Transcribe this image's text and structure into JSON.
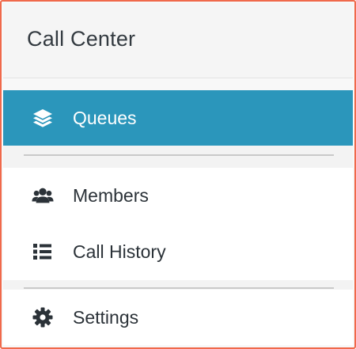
{
  "header": {
    "title": "Call Center"
  },
  "nav": {
    "items": [
      {
        "label": "Queues",
        "icon": "layers-icon",
        "active": true
      },
      {
        "label": "Members",
        "icon": "users-icon",
        "active": false
      },
      {
        "label": "Call History",
        "icon": "list-icon",
        "active": false
      },
      {
        "label": "Settings",
        "icon": "gear-icon",
        "active": false
      }
    ]
  },
  "colors": {
    "accent": "#2b96bb",
    "frame_border": "#f0694b",
    "text": "#2b3238"
  }
}
